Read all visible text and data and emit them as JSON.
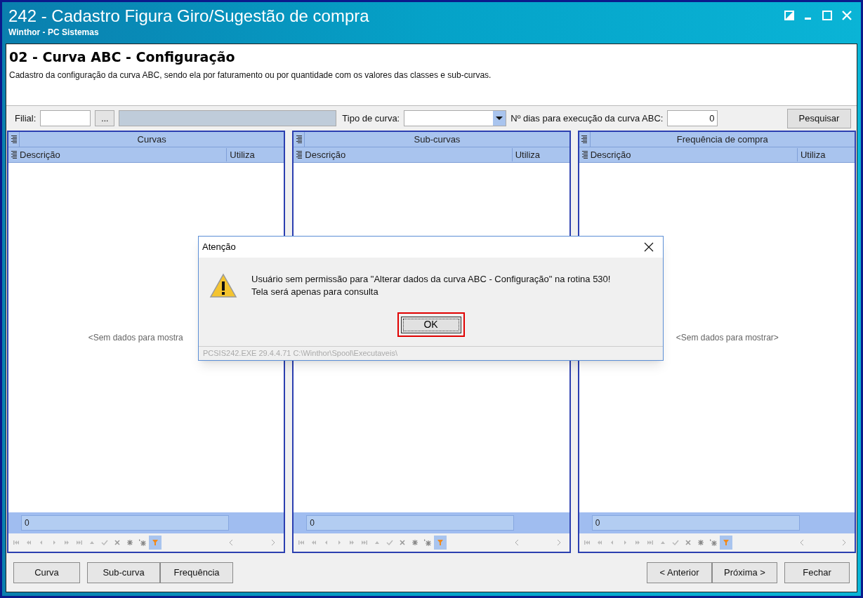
{
  "window": {
    "title": "242 - Cadastro Figura Giro/Sugestão de compra",
    "subtitle": "Winthor - PC Sistemas"
  },
  "header": {
    "step": "02",
    "title": " - Curva ABC - Configuração",
    "description": "Cadastro da configuração da curva ABC, sendo ela por faturamento ou por quantidade com os valores das classes e sub-curvas."
  },
  "filters": {
    "filial_label": "Filial:",
    "ellipsis": "...",
    "tipo_label": "Tipo de curva:",
    "dias_label": "Nº dias para execução da curva ABC:",
    "dias_value": "0",
    "search_button": {
      "label": "Pesquisar"
    }
  },
  "panels": [
    {
      "title": "Curvas",
      "columns": [
        "Descrição",
        "Utiliza"
      ],
      "empty_text": "<Sem dados para mostra",
      "count": "0",
      "filter_selected": true
    },
    {
      "title": "Sub-curvas",
      "columns": [
        "Descrição",
        "Utiliza"
      ],
      "count": "0",
      "filter_selected": true
    },
    {
      "title": "Frequência de compra",
      "columns": [
        "Descrição",
        "Utiliza"
      ],
      "empty_text": "<Sem dados para mostrar>",
      "count": "0",
      "filter_selected": true
    }
  ],
  "left_buttons": [
    {
      "label": "Curva"
    },
    {
      "label": "Sub-curva"
    },
    {
      "label": "Frequência"
    }
  ],
  "right_buttons": [
    {
      "label": "< Anterior"
    },
    {
      "label": "Próxima >"
    },
    {
      "label": "Fechar"
    }
  ],
  "dialog": {
    "title": "Atenção",
    "message": "Usuário sem permissão para \"Alterar dados da curva ABC - Configuração\" na rotina 530!",
    "message_2": "Tela será apenas para consulta",
    "ok_button": {
      "label": "OK",
      "highlighted": true
    },
    "status": "PCSIS242.EXE 29.4.4.71 C:\\Winthor\\Spool\\Executaveis\\"
  }
}
